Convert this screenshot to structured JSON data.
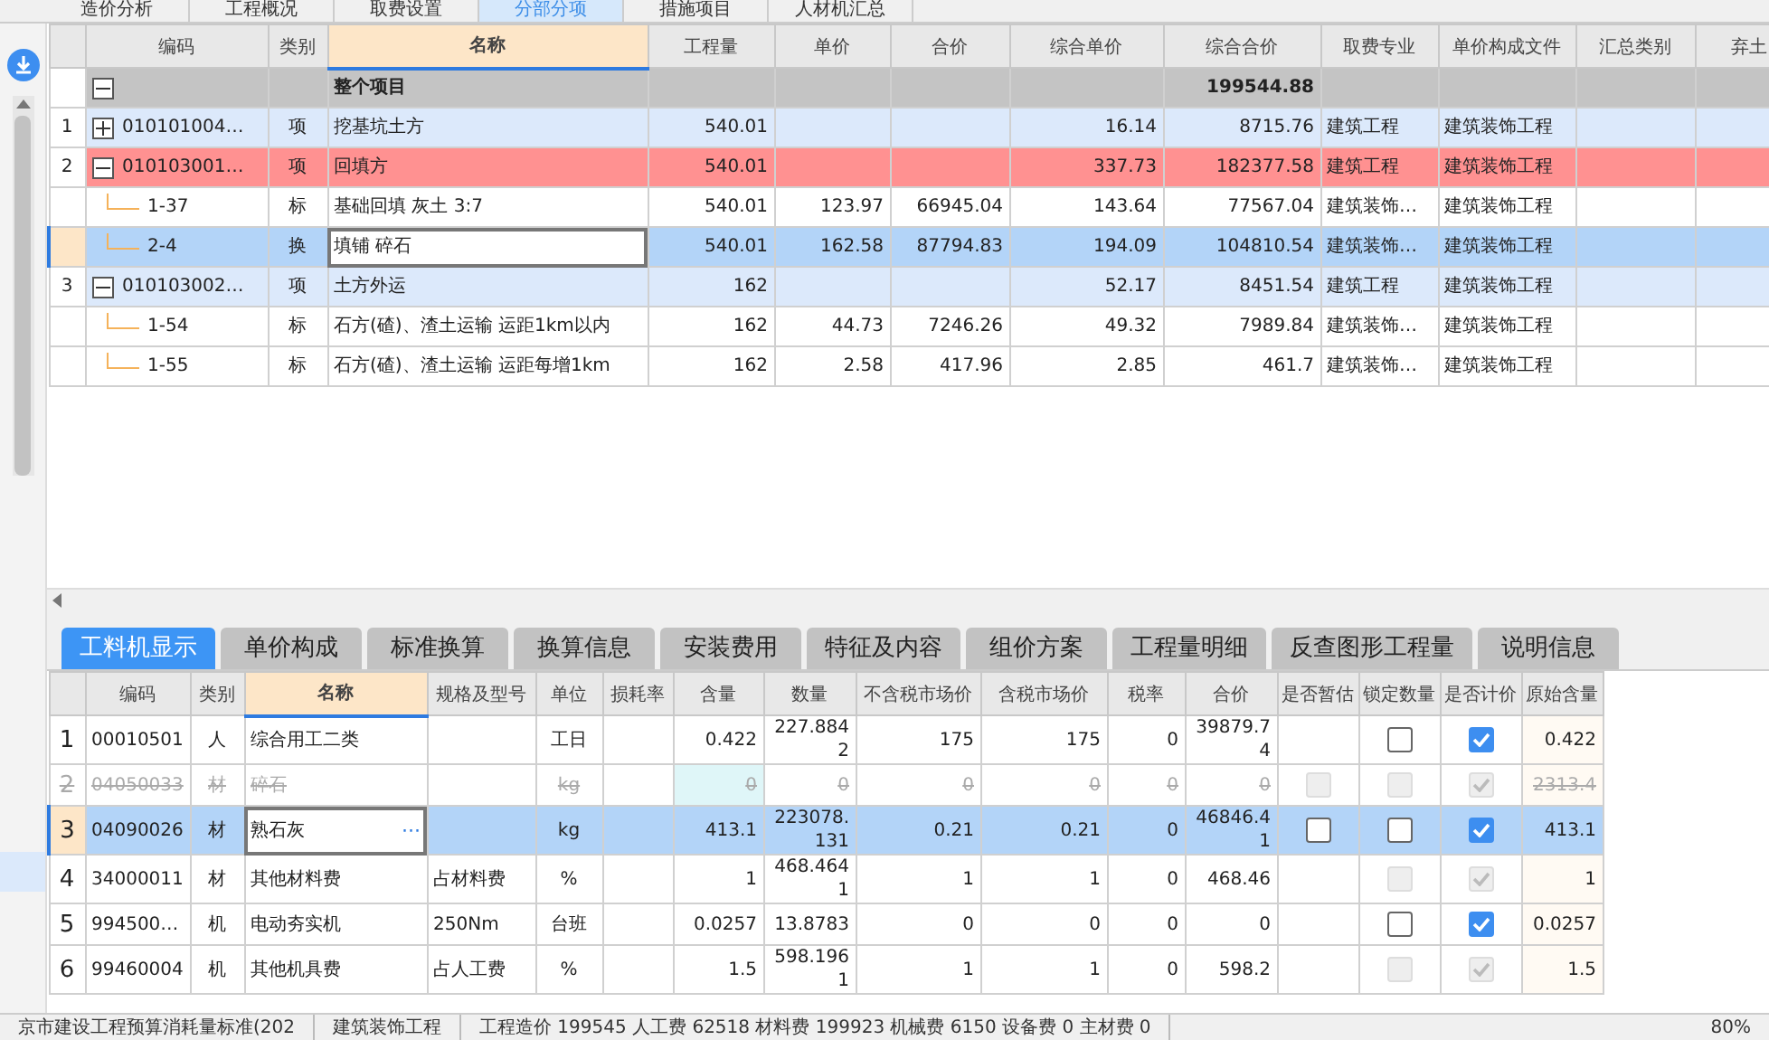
{
  "top_tabs": [
    {
      "label": "造价分析",
      "selected": false
    },
    {
      "label": "工程概况",
      "selected": false
    },
    {
      "label": "取费设置",
      "selected": false
    },
    {
      "label": "分部分项",
      "selected": true
    },
    {
      "label": "措施项目",
      "selected": false
    },
    {
      "label": "人材机汇总",
      "selected": false
    }
  ],
  "upper_table": {
    "columns": [
      "编码",
      "类别",
      "名称",
      "工程量",
      "单价",
      "合价",
      "综合单价",
      "综合合价",
      "取费专业",
      "单价构成文件",
      "汇总类别",
      "弃土"
    ],
    "rows": [
      {
        "kind": "root",
        "expanded": true,
        "flagged": false,
        "selected": false,
        "cells": [
          null,
          null,
          "整个项目",
          null,
          null,
          null,
          null,
          "199544.88",
          null,
          null
        ]
      },
      {
        "kind": "item",
        "number": "1",
        "expanded": false,
        "flagged": false,
        "selected": false,
        "cells": [
          "010101004…",
          "项",
          "挖基坑土方",
          "540.01",
          null,
          null,
          "16.14",
          "8715.76",
          "建筑工程",
          "建筑装饰工程"
        ]
      },
      {
        "kind": "item",
        "number": "2",
        "expanded": true,
        "flagged": true,
        "selected": false,
        "cells": [
          "010103001…",
          "项",
          "回填方",
          "540.01",
          null,
          null,
          "337.73",
          "182377.58",
          "建筑工程",
          "建筑装饰工程"
        ]
      },
      {
        "kind": "sub",
        "flagged": false,
        "selected": false,
        "cells": [
          "1-37",
          "标",
          "基础回填 灰土 3:7",
          "540.01",
          "123.97",
          "66945.04",
          "143.64",
          "77567.04",
          "建筑装饰…",
          "建筑装饰工程"
        ]
      },
      {
        "kind": "sub",
        "flagged": false,
        "selected": true,
        "cells": [
          "2-4",
          "换",
          "填铺 碎石",
          "540.01",
          "162.58",
          "87794.83",
          "194.09",
          "104810.54",
          "建筑装饰…",
          "建筑装饰工程"
        ]
      },
      {
        "kind": "item",
        "number": "3",
        "expanded": true,
        "flagged": false,
        "selected": false,
        "cells": [
          "010103002…",
          "项",
          "土方外运",
          "162",
          null,
          null,
          "52.17",
          "8451.54",
          "建筑工程",
          "建筑装饰工程"
        ]
      },
      {
        "kind": "sub",
        "flagged": false,
        "selected": false,
        "cells": [
          "1-54",
          "标",
          "石方(碴)、渣土运输 运距1km以内",
          "162",
          "44.73",
          "7246.26",
          "49.32",
          "7989.84",
          "建筑装饰…",
          "建筑装饰工程"
        ]
      },
      {
        "kind": "sub",
        "flagged": false,
        "selected": false,
        "cells": [
          "1-55",
          "标",
          "石方(碴)、渣土运输 运距每增1km",
          "162",
          "2.58",
          "417.96",
          "2.85",
          "461.7",
          "建筑装饰…",
          "建筑装饰工程"
        ]
      }
    ]
  },
  "lower_tabs": [
    {
      "label": "工料机显示",
      "selected": true
    },
    {
      "label": "单价构成",
      "selected": false
    },
    {
      "label": "标准换算",
      "selected": false
    },
    {
      "label": "换算信息",
      "selected": false
    },
    {
      "label": "安装费用",
      "selected": false
    },
    {
      "label": "特征及内容",
      "selected": false
    },
    {
      "label": "组价方案",
      "selected": false
    },
    {
      "label": "工程量明细",
      "selected": false
    },
    {
      "label": "反查图形工程量",
      "selected": false
    },
    {
      "label": "说明信息",
      "selected": false
    }
  ],
  "lower_table": {
    "columns": [
      "编码",
      "类别",
      "名称",
      "规格及型号",
      "单位",
      "损耗率",
      "含量",
      "数量",
      "不含税市场价",
      "含税市场价",
      "税率",
      "合价",
      "是否暂估",
      "锁定数量",
      "是否计价",
      "原始含量"
    ],
    "rows": [
      {
        "number": "1",
        "struck": false,
        "selected": false,
        "cells": [
          "00010501",
          "人",
          "综合用工二类",
          null,
          "工日",
          null,
          "0.422",
          "227.8842",
          "175",
          "175",
          "0",
          "39879.74"
        ],
        "locked": {
          "checked": false,
          "disabled": false
        },
        "priced": {
          "checked": true,
          "disabled": false
        },
        "original": "0.422"
      },
      {
        "number": "2",
        "struck": true,
        "selected": false,
        "cells": [
          "04050033",
          "材",
          "碎石",
          null,
          "kg",
          null,
          "0",
          "0",
          "0",
          "0",
          "0",
          "0"
        ],
        "estimate": {
          "checked": false,
          "disabled": true
        },
        "locked": {
          "checked": false,
          "disabled": true
        },
        "priced": {
          "checked": true,
          "disabled": true
        },
        "original": "2313.4"
      },
      {
        "number": "3",
        "struck": false,
        "selected": true,
        "edit_button": "···",
        "cells": [
          "04090026",
          "材",
          "熟石灰",
          null,
          "kg",
          null,
          "413.1",
          "223078.131",
          "0.21",
          "0.21",
          "0",
          "46846.41"
        ],
        "estimate": {
          "checked": false,
          "disabled": false
        },
        "locked": {
          "checked": false,
          "disabled": false
        },
        "priced": {
          "checked": true,
          "disabled": false
        },
        "original": "413.1"
      },
      {
        "number": "4",
        "struck": false,
        "selected": false,
        "cells": [
          "34000011",
          "材",
          "其他材料费",
          "占材料费",
          "%",
          null,
          "1",
          "468.4641",
          "1",
          "1",
          "0",
          "468.46"
        ],
        "locked": {
          "checked": false,
          "disabled": true
        },
        "priced": {
          "checked": true,
          "disabled": true
        },
        "original": "1"
      },
      {
        "number": "5",
        "struck": false,
        "selected": false,
        "cells": [
          "994500…",
          "机",
          "电动夯实机",
          "250Nm",
          "台班",
          null,
          "0.0257",
          "13.8783",
          "0",
          "0",
          "0",
          "0"
        ],
        "locked": {
          "checked": false,
          "disabled": false
        },
        "priced": {
          "checked": true,
          "disabled": false
        },
        "original": "0.0257"
      },
      {
        "number": "6",
        "struck": false,
        "selected": false,
        "cells": [
          "99460004",
          "机",
          "其他机具费",
          "占人工费",
          "%",
          null,
          "1.5",
          "598.1961",
          "1",
          "1",
          "0",
          "598.2"
        ],
        "locked": {
          "checked": false,
          "disabled": true
        },
        "priced": {
          "checked": true,
          "disabled": true
        },
        "original": "1.5"
      }
    ]
  },
  "status_bar": [
    "京市建设工程预算消耗量标准(202",
    "建筑装饰工程",
    "工程造价 199545 人工费 62518 材料费 199923 机械费 6150 设备费 0 主材费 0",
    "80%"
  ]
}
